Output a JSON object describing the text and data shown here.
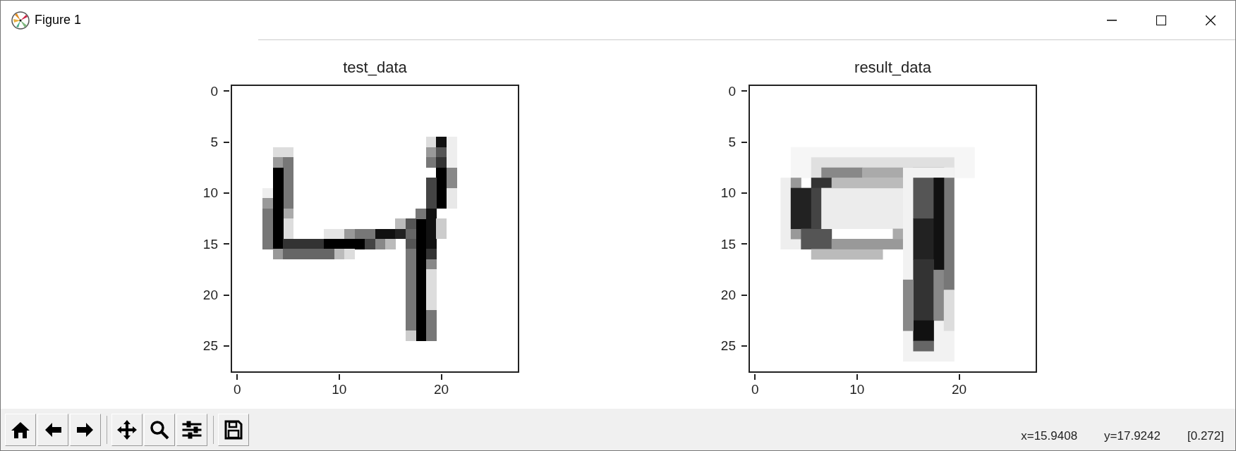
{
  "window": {
    "title": "Figure 1"
  },
  "plots": [
    {
      "title": "test_data",
      "kind": "sharp",
      "xticks": [
        "0",
        "10",
        "20"
      ],
      "yticks": [
        "0",
        "5",
        "10",
        "15",
        "20",
        "25"
      ]
    },
    {
      "title": "result_data",
      "kind": "blurry",
      "xticks": [
        "0",
        "10",
        "20"
      ],
      "yticks": [
        "0",
        "5",
        "10",
        "15",
        "20",
        "25"
      ]
    }
  ],
  "toolbar": [
    [
      {
        "kind": "home"
      },
      {
        "kind": "back"
      },
      {
        "kind": "forward"
      }
    ],
    [
      {
        "kind": "pan"
      },
      {
        "kind": "zoom"
      },
      {
        "kind": "configure"
      }
    ],
    [
      {
        "kind": "save"
      }
    ]
  ],
  "status": {
    "x": "x=15.9408",
    "y": "y=17.9242",
    "value": "[0.272]"
  }
}
